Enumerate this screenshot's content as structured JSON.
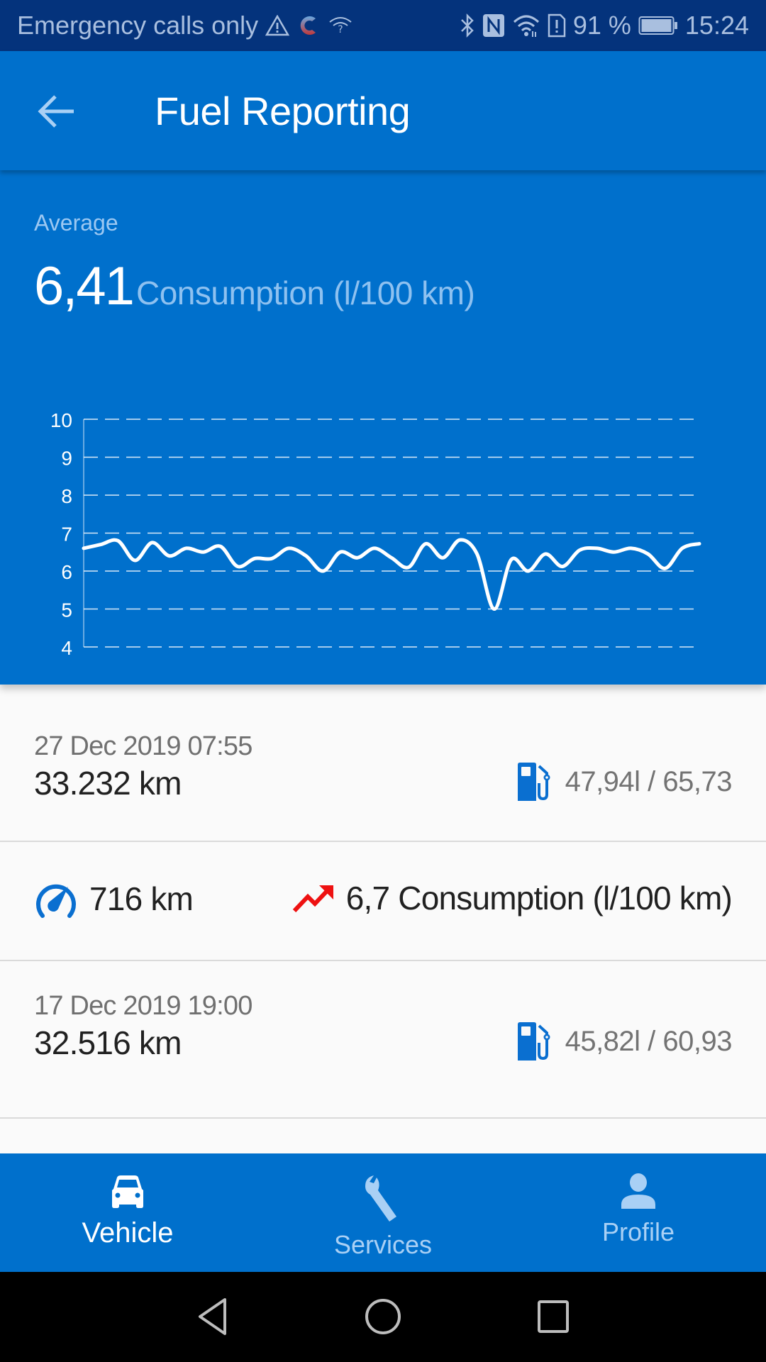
{
  "status_bar": {
    "carrier_text": "Emergency calls only",
    "battery_percent": "91 %",
    "time": "15:24",
    "icons_left": [
      "warning-icon",
      "app-notification-icon",
      "wifi-question-icon"
    ],
    "icons_right": [
      "bluetooth-icon",
      "nfc-icon",
      "wifi-icon",
      "sim-alert-icon",
      "battery-icon"
    ]
  },
  "app_bar": {
    "title": "Fuel Reporting",
    "back_icon": "arrow-left-icon"
  },
  "summary": {
    "label": "Average",
    "value": "6,41",
    "unit": "Consumption (l/100 km)"
  },
  "chart_data": {
    "type": "line",
    "title": "",
    "xlabel": "",
    "ylabel": "",
    "ylim": [
      4,
      10
    ],
    "yticks": [
      "4",
      "5",
      "6",
      "7",
      "8",
      "9",
      "10"
    ],
    "grid": true,
    "legend": "none",
    "series": [
      {
        "name": "Consumption (l/100 km)",
        "values": [
          6.6,
          6.7,
          6.8,
          6.28,
          6.75,
          6.4,
          6.6,
          6.5,
          6.65,
          6.12,
          6.33,
          6.33,
          6.6,
          6.4,
          6.0,
          6.5,
          6.35,
          6.6,
          6.35,
          6.1,
          6.72,
          6.35,
          6.82,
          6.45,
          5.0,
          6.3,
          6.0,
          6.45,
          6.12,
          6.55,
          6.6,
          6.5,
          6.6,
          6.45,
          6.07,
          6.6,
          6.72
        ]
      }
    ],
    "colors": {
      "line": "#ffffff",
      "grid": "#ffffff",
      "background": "#0070cc"
    }
  },
  "entries": [
    {
      "type": "refuel",
      "date": "27 Dec 2019 07:55",
      "odometer": "33.232 km",
      "fuel": "47,94l / 65,73",
      "icon": "fuel-pump-icon"
    },
    {
      "type": "trip",
      "distance": "716 km",
      "consumption": "6,7 Consumption (l/100 km)",
      "distance_icon": "speedometer-icon",
      "trend_icon": "trending-up-icon",
      "trend_color": "#ee1111"
    },
    {
      "type": "refuel",
      "date": "17 Dec 2019 19:00",
      "odometer": "32.516 km",
      "fuel": "45,82l / 60,93",
      "icon": "fuel-pump-icon"
    }
  ],
  "bottom_nav": {
    "items": [
      {
        "label": "Vehicle",
        "icon": "car-icon",
        "active": true
      },
      {
        "label": "Services",
        "icon": "wrench-icon",
        "active": false
      },
      {
        "label": "Profile",
        "icon": "person-icon",
        "active": false
      }
    ]
  },
  "system_nav": {
    "back": "back-triangle-icon",
    "home": "home-circle-icon",
    "recents": "recents-square-icon"
  },
  "colors": {
    "primary": "#0070cc",
    "status_bar": "#04337c",
    "accent_icon": "#0a6fd0",
    "trend_up": "#ee1111",
    "list_bg": "#fafafa"
  }
}
